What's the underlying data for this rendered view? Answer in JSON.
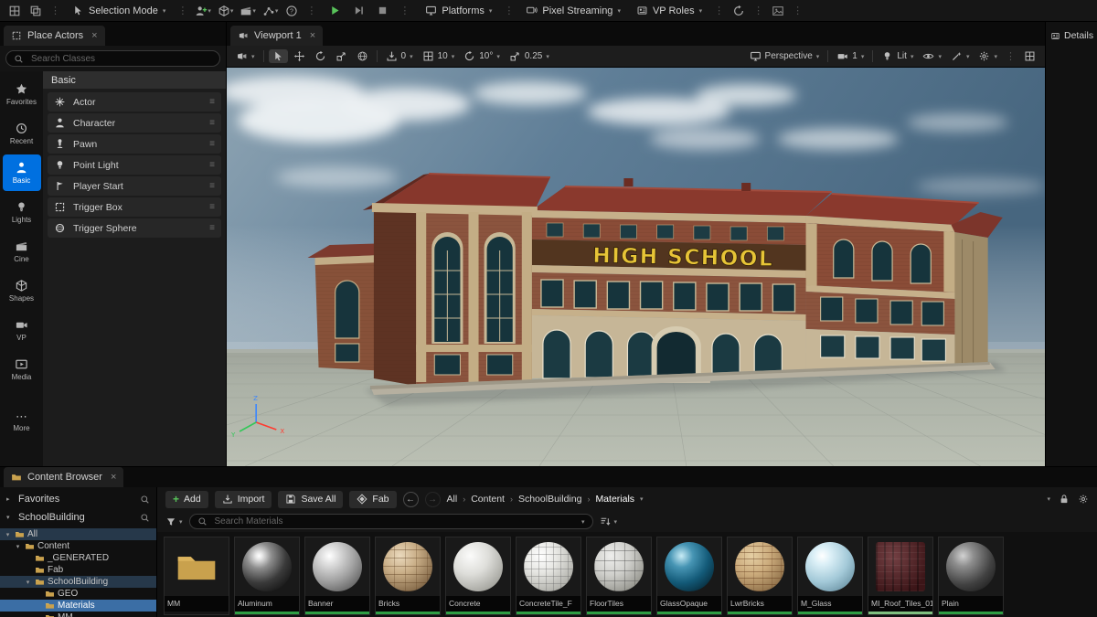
{
  "app": {
    "details_tab": "Details"
  },
  "glyphs": {
    "caret": "▾",
    "expander_open": "▾",
    "expander_closed": "▸",
    "grip": "≡",
    "kebab": "⋮",
    "close": "×",
    "breadcrumb_sep": "›",
    "ellipsis": "⋯"
  },
  "top_toolbar": {
    "selection_mode_label": "Selection Mode",
    "platforms_label": "Platforms",
    "pixel_streaming_label": "Pixel Streaming",
    "vp_roles_label": "VP Roles"
  },
  "place_actors": {
    "tab_label": "Place Actors",
    "search_placeholder": "Search Classes",
    "category_header": "Basic",
    "items": [
      {
        "label": "Actor",
        "icon": "actor"
      },
      {
        "label": "Character",
        "icon": "person"
      },
      {
        "label": "Pawn",
        "icon": "pawn"
      },
      {
        "label": "Point Light",
        "icon": "bulb"
      },
      {
        "label": "Player Start",
        "icon": "flag"
      },
      {
        "label": "Trigger Box",
        "icon": "box"
      },
      {
        "label": "Trigger Sphere",
        "icon": "sphere"
      }
    ],
    "rail": [
      {
        "label": "Favorites",
        "icon": "star",
        "active": false
      },
      {
        "label": "Recent",
        "icon": "clock",
        "active": false
      },
      {
        "label": "Basic",
        "icon": "person",
        "active": true
      },
      {
        "label": "Lights",
        "icon": "bulb",
        "active": false
      },
      {
        "label": "Cine",
        "icon": "clapper",
        "active": false
      },
      {
        "label": "Shapes",
        "icon": "cube",
        "active": false
      },
      {
        "label": "VP",
        "icon": "camera",
        "active": false
      },
      {
        "label": "Media",
        "icon": "media",
        "active": false
      },
      {
        "label": "More",
        "icon": "more",
        "active": false
      }
    ]
  },
  "viewport": {
    "tab_label": "Viewport 1",
    "snap": {
      "surface": "0",
      "translate": "10",
      "rotate": "10°",
      "scale": "0.25"
    },
    "perspective_label": "Perspective",
    "camera_speed": "1",
    "view_mode_label": "Lit",
    "scene": {
      "sign_text": "HIGH SCHOOL",
      "axis_x": "X",
      "axis_y": "Y",
      "axis_z": "Z"
    }
  },
  "content_browser": {
    "tab_label": "Content Browser",
    "sections": {
      "favorites": "Favorites",
      "collection": "SchoolBuilding"
    },
    "tree": [
      {
        "label": "All",
        "depth": 0,
        "arrow": "down",
        "state": "row-highlight"
      },
      {
        "label": "Content",
        "depth": 1,
        "arrow": "down",
        "state": ""
      },
      {
        "label": "_GENERATED",
        "depth": 2,
        "arrow": "none",
        "state": ""
      },
      {
        "label": "Fab",
        "depth": 2,
        "arrow": "none",
        "state": ""
      },
      {
        "label": "SchoolBuilding",
        "depth": 2,
        "arrow": "down",
        "state": "row-highlight"
      },
      {
        "label": "GEO",
        "depth": 3,
        "arrow": "none",
        "state": ""
      },
      {
        "label": "Materials",
        "depth": 3,
        "arrow": "none",
        "state": "selected"
      },
      {
        "label": "MM",
        "depth": 3,
        "arrow": "none",
        "state": ""
      }
    ],
    "toolbar": {
      "add": "Add",
      "import": "Import",
      "save_all": "Save All",
      "fab": "Fab"
    },
    "breadcrumb": [
      "All",
      "Content",
      "SchoolBuilding",
      "Materials"
    ],
    "search_placeholder": "Search Materials",
    "assets": [
      {
        "name": "MM",
        "kind": "folder",
        "style": "folder"
      },
      {
        "name": "Aluminum",
        "kind": "material",
        "style": "aluminum"
      },
      {
        "name": "Banner",
        "kind": "material",
        "style": "banner"
      },
      {
        "name": "Bricks",
        "kind": "material",
        "style": "bricks"
      },
      {
        "name": "Concrete",
        "kind": "material",
        "style": "concrete"
      },
      {
        "name": "ConcreteTile_F",
        "kind": "material",
        "style": "concretetile"
      },
      {
        "name": "FloorTiles",
        "kind": "material",
        "style": "floortiles"
      },
      {
        "name": "GlassOpaque",
        "kind": "material",
        "style": "glassopaque"
      },
      {
        "name": "LwrBricks",
        "kind": "material",
        "style": "lwrbricks"
      },
      {
        "name": "M_Glass",
        "kind": "material",
        "style": "mglass"
      },
      {
        "name": "MI_Roof_Tiles_01",
        "kind": "material-instance",
        "style": "rooftiles"
      },
      {
        "name": "Plain",
        "kind": "material",
        "style": "plain"
      }
    ]
  },
  "colors": {
    "accent": "#0070e0",
    "selection_blue": "#3b6ea5",
    "material_badge_green": "#2f9e44",
    "play_green": "#58c35a",
    "sign_yellow": "#e7c437",
    "roof_red": "#8a392d",
    "brick": "#8b543e",
    "tan_stone": "#c6b08a"
  }
}
